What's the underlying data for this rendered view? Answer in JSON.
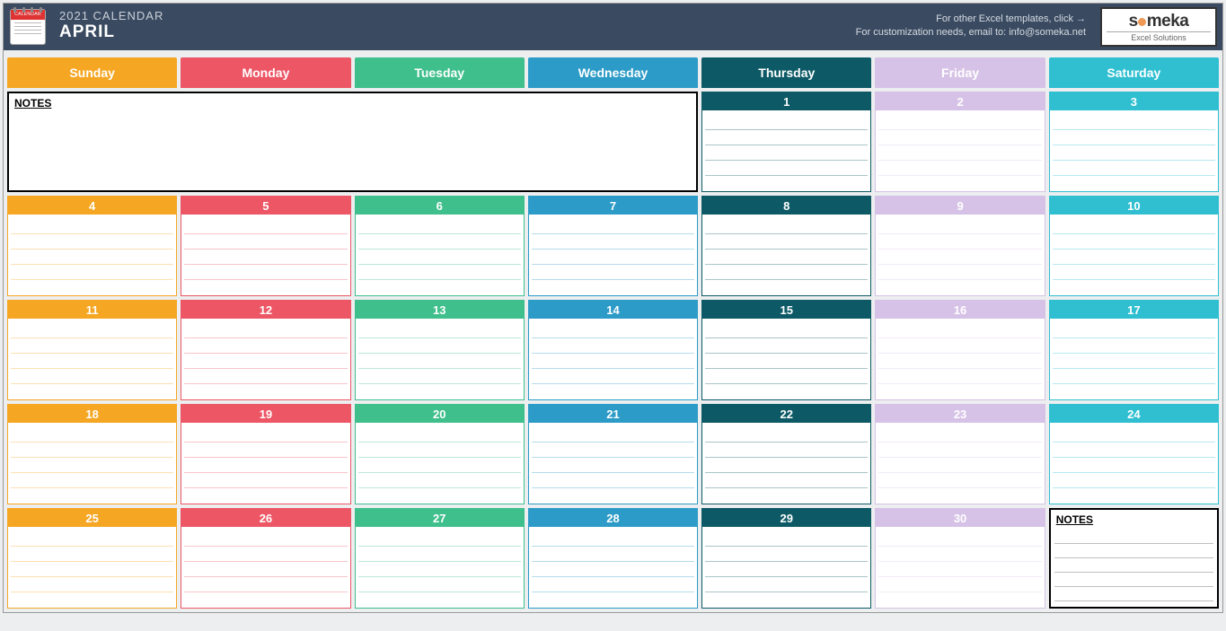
{
  "header": {
    "title_small": "2021 CALENDAR",
    "title_big": "APRIL",
    "link_line1": "For other Excel templates, click →",
    "link_line2": "For customization needs, email to: info@someka.net",
    "logo_top": "someka",
    "logo_bottom": "Excel Solutions"
  },
  "weekdays": [
    {
      "label": "Sunday",
      "color": "#f5a623"
    },
    {
      "label": "Monday",
      "color": "#ec5665"
    },
    {
      "label": "Tuesday",
      "color": "#3fbf8c"
    },
    {
      "label": "Wednesday",
      "color": "#2c9bc7"
    },
    {
      "label": "Thursday",
      "color": "#0d5a66"
    },
    {
      "label": "Friday",
      "color": "#d6c2e6"
    },
    {
      "label": "Saturday",
      "color": "#2fbfd1"
    }
  ],
  "notes_label": "NOTES",
  "calendar": [
    [
      {
        "type": "notes-big",
        "span": 4
      },
      {
        "type": "day",
        "n": "1",
        "col": 4
      },
      {
        "type": "day",
        "n": "2",
        "col": 5
      },
      {
        "type": "day",
        "n": "3",
        "col": 6
      }
    ],
    [
      {
        "type": "day",
        "n": "4",
        "col": 0
      },
      {
        "type": "day",
        "n": "5",
        "col": 1
      },
      {
        "type": "day",
        "n": "6",
        "col": 2
      },
      {
        "type": "day",
        "n": "7",
        "col": 3
      },
      {
        "type": "day",
        "n": "8",
        "col": 4
      },
      {
        "type": "day",
        "n": "9",
        "col": 5
      },
      {
        "type": "day",
        "n": "10",
        "col": 6
      }
    ],
    [
      {
        "type": "day",
        "n": "11",
        "col": 0
      },
      {
        "type": "day",
        "n": "12",
        "col": 1
      },
      {
        "type": "day",
        "n": "13",
        "col": 2
      },
      {
        "type": "day",
        "n": "14",
        "col": 3
      },
      {
        "type": "day",
        "n": "15",
        "col": 4
      },
      {
        "type": "day",
        "n": "16",
        "col": 5
      },
      {
        "type": "day",
        "n": "17",
        "col": 6
      }
    ],
    [
      {
        "type": "day",
        "n": "18",
        "col": 0
      },
      {
        "type": "day",
        "n": "19",
        "col": 1
      },
      {
        "type": "day",
        "n": "20",
        "col": 2
      },
      {
        "type": "day",
        "n": "21",
        "col": 3
      },
      {
        "type": "day",
        "n": "22",
        "col": 4
      },
      {
        "type": "day",
        "n": "23",
        "col": 5
      },
      {
        "type": "day",
        "n": "24",
        "col": 6
      }
    ],
    [
      {
        "type": "day",
        "n": "25",
        "col": 0
      },
      {
        "type": "day",
        "n": "26",
        "col": 1
      },
      {
        "type": "day",
        "n": "27",
        "col": 2
      },
      {
        "type": "day",
        "n": "28",
        "col": 3
      },
      {
        "type": "day",
        "n": "29",
        "col": 4
      },
      {
        "type": "day",
        "n": "30",
        "col": 5
      },
      {
        "type": "notes-small",
        "col": 6
      }
    ]
  ]
}
